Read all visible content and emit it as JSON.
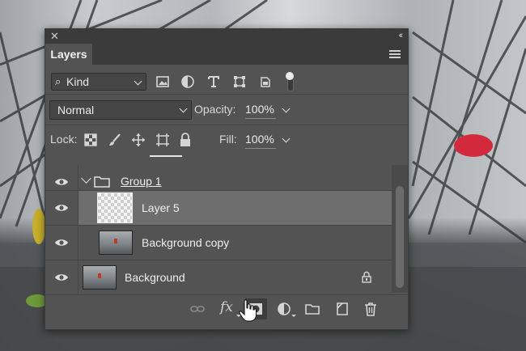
{
  "panel": {
    "tab_label": "Layers",
    "kind_filter": {
      "label": "Kind"
    },
    "blend_mode": "Normal",
    "opacity": {
      "label": "Opacity:",
      "value": "100%"
    },
    "lock": {
      "label": "Lock:"
    },
    "fill": {
      "label": "Fill:",
      "value": "100%"
    }
  },
  "filter_icons": [
    "image-filter-icon",
    "adjustment-filter-icon",
    "type-filter-icon",
    "shape-filter-icon",
    "smart-object-filter-icon"
  ],
  "lock_icons": [
    "lock-transparent-pixels-icon",
    "lock-image-pixels-icon",
    "lock-position-icon",
    "lock-artboard-icon",
    "lock-all-icon"
  ],
  "layers": [
    {
      "name": "Group 1",
      "type": "group",
      "expanded": true,
      "visible": true
    },
    {
      "name": "Layer 5",
      "type": "layer",
      "selected": true,
      "visible": true,
      "in_group": true
    },
    {
      "name": "Background copy",
      "type": "layer",
      "visible": true,
      "in_group": true
    },
    {
      "name": "Background",
      "type": "layer",
      "locked": true,
      "visible": true
    }
  ],
  "bottom_icons": [
    "link-layers-icon",
    "fx-icon",
    "add-mask-icon",
    "new-adjustment-layer-icon",
    "new-group-icon",
    "new-layer-icon",
    "delete-layer-icon"
  ],
  "bottom_labels": {
    "fx": "fx"
  },
  "colors": {
    "panel_bg": "#535353",
    "selected_row": "#6e6e6e",
    "header_bg": "#3b3b3b"
  }
}
